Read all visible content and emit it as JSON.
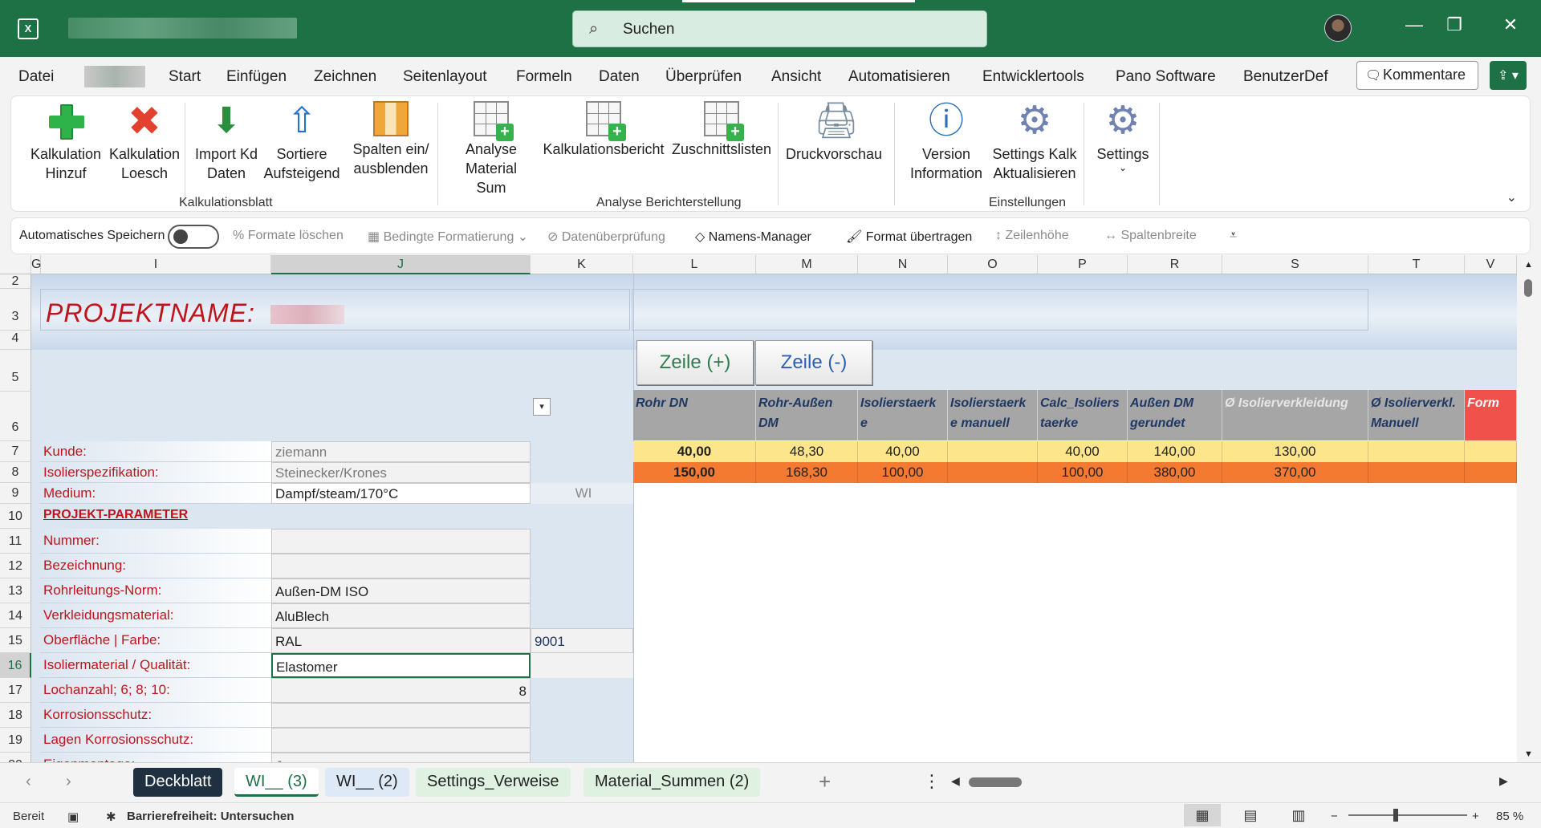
{
  "titlebar": {
    "search_label": "Suchen",
    "minimize": "—",
    "restore": "❐",
    "close": "✕"
  },
  "menu": {
    "items": [
      "Datei",
      "Start",
      "Einfügen",
      "Zeichnen",
      "Seitenlayout",
      "Formeln",
      "Daten",
      "Überprüfen",
      "Ansicht",
      "Automatisieren",
      "Entwicklertools",
      "Pano Software",
      "BenutzerDef"
    ],
    "kommentare": "Kommentare"
  },
  "ribbon": {
    "buttons": {
      "kalk_hinzu": "Kalkulation Hinzuf",
      "kalk_loesch": "Kalkulation Loesch",
      "import": "Import Kd Daten",
      "sortiere": "Sortiere Aufsteigend",
      "spalten": "Spalten ein/ ausblenden",
      "analyse": "Analyse Material Sum",
      "kalkbericht": "Kalkulationsbericht",
      "zuschnitt": "Zuschnittslisten",
      "druck": "Druckvorschau",
      "version": "Version Information",
      "settings_kalk": "Settings Kalk Aktualisieren",
      "settings": "Settings"
    },
    "groups": {
      "kalkulationsblatt": "Kalkulationsblatt",
      "analyse": "Analyse Berichterstellung",
      "einstellungen": "Einstellungen"
    }
  },
  "qat": {
    "autosave": "Automatisches Speichern",
    "formate_loeschen": "Formate löschen",
    "bedingte": "Bedingte Formatierung",
    "datenpruefung": "Datenüberprüfung",
    "namens": "Namens-Manager",
    "format_uebertragen": "Format übertragen",
    "zeilenhoehe": "Zeilenhöhe",
    "spaltenbreite": "Spaltenbreite"
  },
  "columns": [
    "G",
    "I",
    "J",
    "K",
    "L",
    "M",
    "N",
    "O",
    "P",
    "R",
    "S",
    "T",
    "V"
  ],
  "rows": [
    "2",
    "3",
    "4",
    "5",
    "6",
    "7",
    "8",
    "9",
    "10",
    "11",
    "12",
    "13",
    "14",
    "15",
    "16",
    "17",
    "18",
    "19",
    "20"
  ],
  "sheet": {
    "projektname": "PROJEKTNAME:",
    "btn_plus": "Zeile (+)",
    "btn_minus": "Zeile (-)",
    "fields": [
      {
        "label": "Kunde:",
        "value": "ziemann"
      },
      {
        "label": "Isolierspezifikation:",
        "value": "Steinecker/Krones"
      },
      {
        "label": "Medium:",
        "value": "Dampf/steam/170°C",
        "extra": "WI"
      },
      {
        "label": "PROJEKT-PARAMETER",
        "value": ""
      },
      {
        "label": "Nummer:",
        "value": ""
      },
      {
        "label": "Bezeichnung:",
        "value": ""
      },
      {
        "label": "Rohrleitungs-Norm:",
        "value": "Außen-DM ISO"
      },
      {
        "label": "Verkleidungsmaterial:",
        "value": "AluBlech"
      },
      {
        "label": "Oberfläche | Farbe:",
        "value": "RAL",
        "extra": "9001"
      },
      {
        "label": "Isoliermaterial / Qualität:",
        "value": "Elastomer"
      },
      {
        "label": "Lochanzahl; 6; 8; 10:",
        "value": "8"
      },
      {
        "label": "Korrosionsschutz:",
        "value": ""
      },
      {
        "label": "Lagen Korrosionsschutz:",
        "value": ""
      },
      {
        "label": "Eigenmontage:",
        "value": "Ja"
      }
    ],
    "table_headers": [
      "Rohr DN",
      "Rohr-Außen DM",
      "Isolierstaerk e",
      "Isolierstaerk e manuell",
      "Calc_Isoliers taerke",
      "Außen DM gerundet",
      "Ø Isolierverkleidung",
      "Ø Isolierverkl. Manuell",
      "Form"
    ],
    "table_rows": [
      [
        "40,00",
        "48,30",
        "40,00",
        "",
        "40,00",
        "140,00",
        "130,00",
        "",
        ""
      ],
      [
        "150,00",
        "168,30",
        "100,00",
        "",
        "100,00",
        "380,00",
        "370,00",
        "",
        ""
      ]
    ]
  },
  "tabs": [
    "Deckblatt",
    "WI__ (3)",
    "WI__ (2)",
    "Settings_Verweise",
    "Material_Summen (2)"
  ],
  "status": {
    "ready": "Bereit",
    "accessibility": "Barrierefreiheit: Untersuchen",
    "zoom": "85 %"
  }
}
